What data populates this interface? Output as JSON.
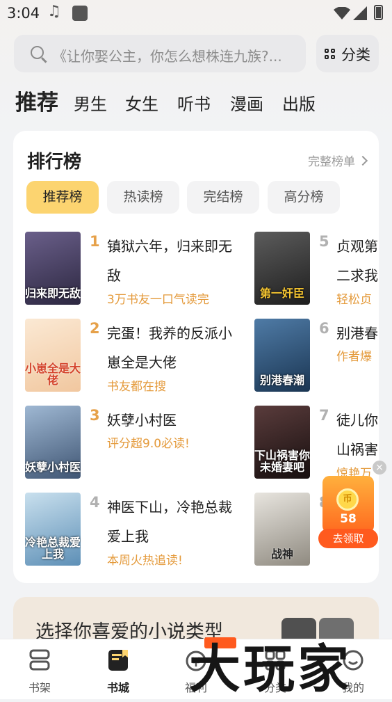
{
  "status_bar": {
    "time": "3:04"
  },
  "search": {
    "placeholder": "《让你娶公主，你怎么想株连九族?..."
  },
  "category_button": {
    "label": "分类"
  },
  "top_tabs": [
    {
      "label": "推荐",
      "active": true
    },
    {
      "label": "男生"
    },
    {
      "label": "女生"
    },
    {
      "label": "听书"
    },
    {
      "label": "漫画"
    },
    {
      "label": "出版"
    }
  ],
  "ranking": {
    "title": "排行榜",
    "more": "完整榜单",
    "chips": [
      {
        "label": "推荐榜",
        "active": true
      },
      {
        "label": "热读榜"
      },
      {
        "label": "完结榜"
      },
      {
        "label": "高分榜"
      }
    ],
    "books": [
      {
        "rank": "1",
        "name": "镇狱六年，归来即无敌",
        "tag": "3万书友一口气读完",
        "cover_text": "归来即无敌",
        "cover_color": "#3a3450"
      },
      {
        "rank": "2",
        "name": "完蛋！我养的反派小崽全是大佬",
        "tag": "书友都在搜",
        "cover_text": "小崽全是大佬",
        "cover_color": "#f6dcc2"
      },
      {
        "rank": "3",
        "name": "妖孽小村医",
        "tag": "评分超9.0必读!",
        "cover_text": "妖孽小村医",
        "cover_color": "#5f7aa0"
      },
      {
        "rank": "4",
        "name": "神医下山，冷艳总裁爱上我",
        "tag": "本周火热追读!",
        "cover_text": "冷艳总裁爱上我",
        "cover_color": "#7da9c9"
      },
      {
        "rank": "5",
        "name": "贞观第二求我",
        "tag": "轻松贞",
        "cover_text": "第一奸臣",
        "cover_color": "#3b3b3b"
      },
      {
        "rank": "6",
        "name": "别港春",
        "tag": "作者爆",
        "cover_text": "别港春潮",
        "cover_color": "#2b4f73"
      },
      {
        "rank": "7",
        "name": "徒儿你山祸害",
        "tag": "惊艳万",
        "cover_text": "下山祸害你未婚妻吧",
        "cover_color": "#2a1e1e"
      },
      {
        "rank": "8",
        "name": "",
        "tag": "",
        "cover_text": "战神",
        "cover_color": "#c9c5bd"
      }
    ]
  },
  "reward": {
    "amount": "58",
    "action": "去领取",
    "coin_label": "币"
  },
  "genre_banner": {
    "text": "选择你喜爱的小说类型"
  },
  "bottom_nav": [
    {
      "label": "书架",
      "icon": "bookshelf-icon"
    },
    {
      "label": "书城",
      "icon": "bookstore-icon",
      "active": true
    },
    {
      "label": "福利",
      "icon": "welfare-icon"
    },
    {
      "label": "分类",
      "icon": "category-icon"
    },
    {
      "label": "我的",
      "icon": "profile-icon"
    }
  ],
  "watermark": "大玩家",
  "colors": {
    "accent": "#fcd470",
    "tag": "#e49a3b",
    "reward": "#ff6a1f"
  }
}
